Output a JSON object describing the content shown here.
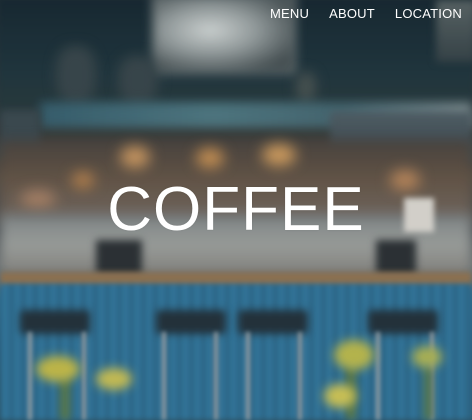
{
  "nav": {
    "items": [
      {
        "label": "MENU"
      },
      {
        "label": "ABOUT"
      },
      {
        "label": "LOCATION"
      }
    ]
  },
  "hero": {
    "title": "COFFEE",
    "background": "blurred-cafe-interior-photo"
  },
  "colors": {
    "text": "#ffffff",
    "bar_blue": "#2f6f91",
    "warm_light": "#d9a266"
  }
}
